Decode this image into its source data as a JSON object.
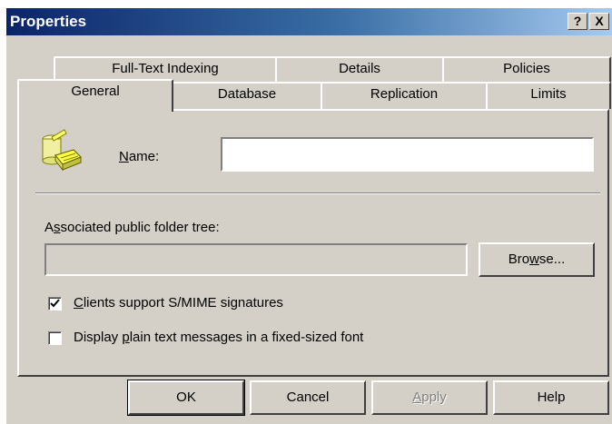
{
  "window": {
    "title": "Properties",
    "help_button": "?",
    "close_button": "X"
  },
  "tabs": {
    "row1": [
      {
        "label": "Full-Text Indexing"
      },
      {
        "label": "Details"
      },
      {
        "label": "Policies"
      }
    ],
    "row2": [
      {
        "label": "General",
        "active": true
      },
      {
        "label": "Database"
      },
      {
        "label": "Replication"
      },
      {
        "label": "Limits"
      }
    ]
  },
  "general": {
    "name_label_prefix": "",
    "name_label_accel": "N",
    "name_label_rest": "ame:",
    "name_value": "",
    "folder_tree_label_prefix": "A",
    "folder_tree_label_accel": "s",
    "folder_tree_label_rest": "sociated public folder tree:",
    "folder_tree_value": "",
    "browse_label_prefix": "Bro",
    "browse_label_accel": "w",
    "browse_label_rest": "se...",
    "checkbox_smime": {
      "prefix": "",
      "accel": "C",
      "rest": "lients support S/MIME signatures",
      "checked": true
    },
    "checkbox_plaintext": {
      "prefix": "Display ",
      "accel": "p",
      "rest": "lain text messages in a fixed-sized font",
      "checked": false
    }
  },
  "footer": {
    "ok": "OK",
    "cancel": "Cancel",
    "apply_accel": "A",
    "apply_rest": "pply",
    "help": "Help"
  },
  "icons": {
    "store": "public-store-icon",
    "check": "checkmark-icon"
  }
}
